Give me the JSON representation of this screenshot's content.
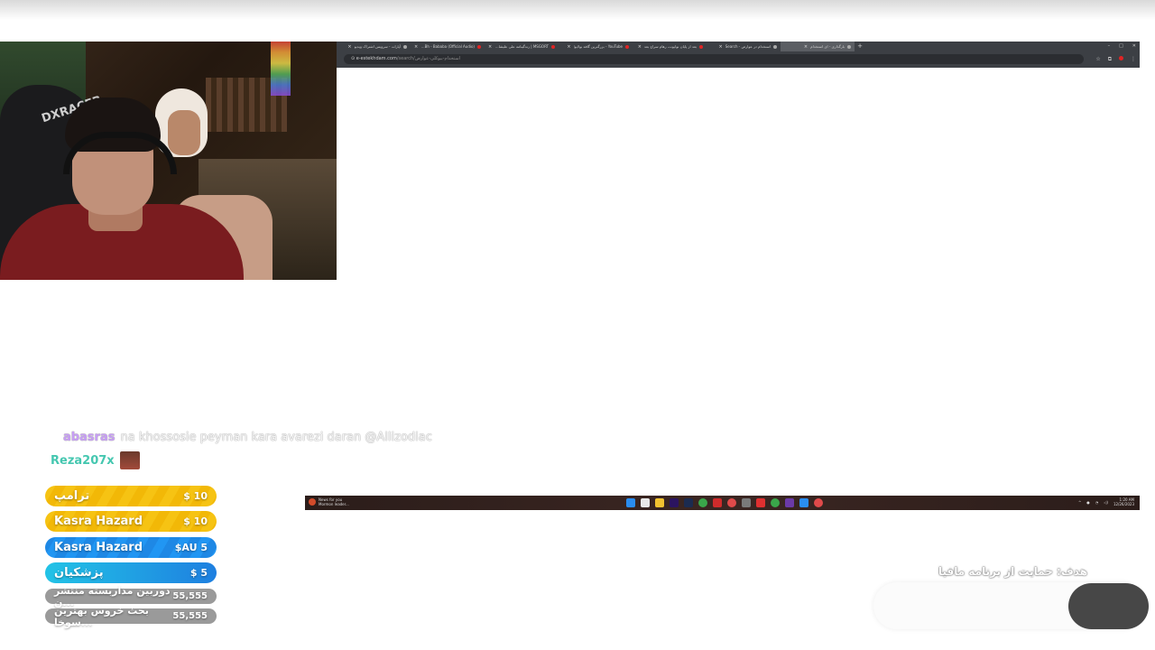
{
  "browser": {
    "tabs": [
      {
        "title": "آپارات - سرویس اشتراک ویدیو",
        "favicon": "aparat-icon",
        "active": false
      },
      {
        "title": "DariusBh - Bababa (Official Audio)",
        "favicon": "youtube-icon",
        "active": false
      },
      {
        "title": "MSGORT | زندگینامه علی علیشاهی",
        "favicon": "youtube-icon",
        "active": false
      },
      {
        "title": "YouTube - بزرگترین گافه بولایوا",
        "favicon": "youtube-icon",
        "active": false
      },
      {
        "title": "بعد از پایان نوایوت، رهام سراج بعد",
        "favicon": "youtube-icon",
        "active": false
      },
      {
        "title": "استخدام در عوارض - Search",
        "favicon": "search-icon",
        "active": false
      },
      {
        "title": "بارگذاری - ای استخدام",
        "favicon": "page-icon",
        "active": true
      }
    ],
    "url_domain": "e-estekhdam.com",
    "url_path": "/search/استخدام-بیوکلی-عوارض",
    "url_sub": "استخدام-بیوکلی-عوارض"
  },
  "taskbar": {
    "news_title": "News for you",
    "news_sub": "Mormon leader...",
    "time": "1:20 AM",
    "date": "12/26/2023"
  },
  "chat": [
    {
      "user": "abasras",
      "message": "na khossosie peyman kara avarezi daran @Allizodiac",
      "user_color": "#c79ef5"
    },
    {
      "user": "Reza207x",
      "message": "",
      "user_color": "#45c7b0"
    }
  ],
  "donations": [
    {
      "name": "ترامپ",
      "amount": "$ 10"
    },
    {
      "name": "Kasra Hazard",
      "amount": "$ 10"
    },
    {
      "name": "Kasra Hazard",
      "amount": "$AU 5"
    },
    {
      "name": "پزشکیان",
      "amount": "$ 5"
    },
    {
      "name": "دوربین مداربسته منتشر ن...",
      "amount": "55,555"
    },
    {
      "name": "بحث خروس بهترین سوخا...",
      "amount": "55,555"
    }
  ],
  "goal": {
    "label": "هدف: حمایت از برنامه مافیا"
  },
  "colors": {
    "accent_yellow": "#f6c313",
    "accent_blue": "#1e88e5",
    "pill_gray": "#474747"
  }
}
